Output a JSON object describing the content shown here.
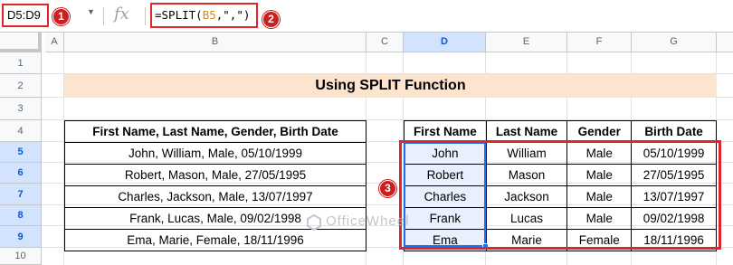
{
  "formula_bar": {
    "name_box": "D5:D9",
    "dropdown_icon": "triangle-down-icon",
    "fx_icon": "fx",
    "formula_prefix": "=SPLIT(",
    "formula_ref": "B5",
    "formula_suffix": ",\",\")"
  },
  "badges": [
    "1",
    "2",
    "3"
  ],
  "columns": [
    "A",
    "B",
    "C",
    "D",
    "E",
    "F",
    "G"
  ],
  "rows": [
    "1",
    "2",
    "3",
    "4",
    "5",
    "6",
    "7",
    "8",
    "9",
    "10"
  ],
  "title": "Using SPLIT Function",
  "left_table": {
    "header": "First Name, Last Name, Gender, Birth Date",
    "rows": [
      "John, William, Male, 05/10/1999",
      "Robert, Mason, Male, 27/05/1995",
      "Charles, Jackson, Male, 13/07/1997",
      "Frank, Lucas, Male, 09/02/1998",
      "Ema, Marie, Female, 18/11/1996"
    ]
  },
  "right_table": {
    "headers": [
      "First Name",
      "Last Name",
      "Gender",
      "Birth Date"
    ],
    "rows": [
      [
        "John",
        "William",
        "Male",
        "05/10/1999"
      ],
      [
        "Robert",
        "Mason",
        "Male",
        "27/05/1995"
      ],
      [
        "Charles",
        "Jackson",
        "Male",
        "13/07/1997"
      ],
      [
        "Frank",
        "Lucas",
        "Male",
        "09/02/1998"
      ],
      [
        "Ema",
        "Marie",
        "Female",
        "18/11/1996"
      ]
    ]
  },
  "watermark": "OfficeWheel",
  "colors": {
    "accent_red": "#e0262a",
    "selection_blue": "#1a73e8",
    "title_fill": "#fce4cf",
    "header_selected": "#d3e3fd"
  }
}
